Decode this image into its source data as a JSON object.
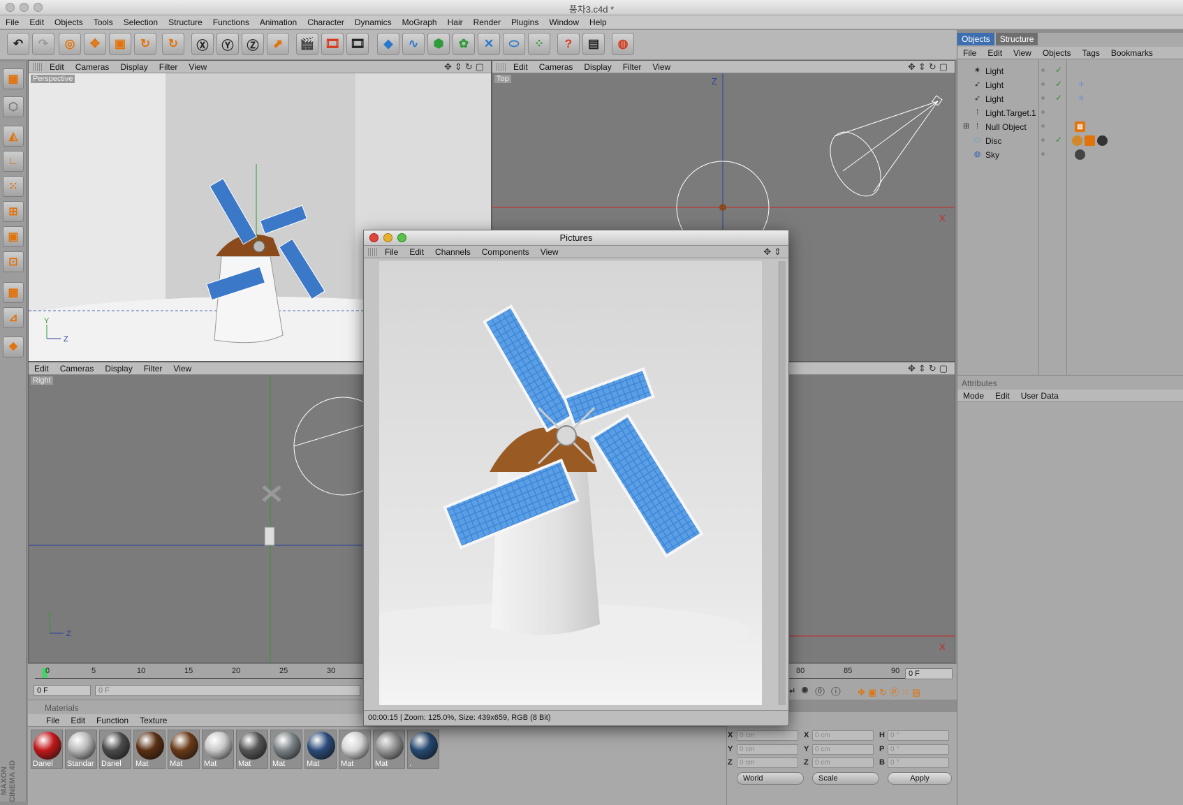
{
  "window": {
    "title": "풍차3.c4d *"
  },
  "menubar": [
    "File",
    "Edit",
    "Objects",
    "Tools",
    "Selection",
    "Structure",
    "Functions",
    "Animation",
    "Character",
    "Dynamics",
    "MoGraph",
    "Hair",
    "Render",
    "Plugins",
    "Window",
    "Help"
  ],
  "viewports": {
    "perspective": {
      "label": "Perspective",
      "menu": [
        "Edit",
        "Cameras",
        "Display",
        "Filter",
        "View"
      ],
      "axis_y": "Y",
      "axis_z": "Z"
    },
    "top": {
      "label": "Top",
      "menu": [
        "Edit",
        "Cameras",
        "Display",
        "Filter",
        "View"
      ],
      "axis_z": "Z",
      "axis_x": "X"
    },
    "right": {
      "label": "Right",
      "menu": [
        "Edit",
        "Cameras",
        "Display",
        "Filter",
        "View"
      ],
      "axis_y": "Y",
      "axis_z": "Z"
    },
    "front": {
      "axis_x": "X"
    }
  },
  "object_manager": {
    "tabs": [
      "Objects",
      "Structure"
    ],
    "menu": [
      "File",
      "Edit",
      "View",
      "Objects",
      "Tags",
      "Bookmarks"
    ],
    "items": [
      {
        "name": "Light",
        "icon": "light-icon"
      },
      {
        "name": "Light",
        "icon": "spot-light-icon"
      },
      {
        "name": "Light",
        "icon": "spot-light-icon"
      },
      {
        "name": "Light.Target.1",
        "icon": "target-icon"
      },
      {
        "name": "Null Object",
        "icon": "null-icon"
      },
      {
        "name": "Disc",
        "icon": "disc-icon"
      },
      {
        "name": "Sky",
        "icon": "sky-icon"
      }
    ]
  },
  "attributes": {
    "title": "Attributes",
    "menu": [
      "Mode",
      "Edit",
      "User Data"
    ]
  },
  "timeline": {
    "ticks": [
      "0",
      "5",
      "10",
      "15",
      "20",
      "25",
      "30",
      "80",
      "85",
      "90"
    ],
    "current_frame": "0 F",
    "end_field": "0 F",
    "start_field": "0 F"
  },
  "materials": {
    "title": "Materials",
    "menu": [
      "File",
      "Edit",
      "Function",
      "Texture"
    ],
    "items": [
      {
        "name": "Danel",
        "color": "#c0181a"
      },
      {
        "name": "Standar",
        "color": "#b9b9b9"
      },
      {
        "name": "Danel",
        "color": "#4a4a4a"
      },
      {
        "name": "Mat",
        "color": "#5a2f12"
      },
      {
        "name": "Mat",
        "color": "#6a3a18"
      },
      {
        "name": "Mat",
        "color": "#c8c8c8"
      },
      {
        "name": "Mat",
        "color": "#555555"
      },
      {
        "name": "Mat",
        "color": "#7a8286"
      },
      {
        "name": "Mat",
        "color": "#2a4c7a"
      },
      {
        "name": "Mat",
        "color": "#d6d6d6"
      },
      {
        "name": "Mat",
        "color": "#9a9a9a"
      },
      {
        "name": ".",
        "color": "#264a74"
      }
    ]
  },
  "coordinates": {
    "rows": [
      {
        "pos_label": "X",
        "pos_value": "0 cm",
        "size_label": "X",
        "size_value": "0 cm",
        "rot_label": "H",
        "rot_value": "0 °"
      },
      {
        "pos_label": "Y",
        "pos_value": "0 cm",
        "size_label": "Y",
        "size_value": "0 cm",
        "rot_label": "P",
        "rot_value": "0 °"
      },
      {
        "pos_label": "Z",
        "pos_value": "0 cm",
        "size_label": "Z",
        "size_value": "0 cm",
        "rot_label": "B",
        "rot_value": "0 °"
      }
    ],
    "mode_select": "World",
    "scale_select": "Scale",
    "apply_label": "Apply"
  },
  "pictures": {
    "title": "Pictures",
    "menu": [
      "File",
      "Edit",
      "Channels",
      "Components",
      "View"
    ],
    "status": "00:00:15 | Zoom: 125.0%, Size: 439x659, RGB (8 Bit)"
  },
  "branding": "MAXON CINEMA 4D",
  "colors": {
    "accent_orange": "#e2720a",
    "panel_blue": "#4d8fd8",
    "x_axis": "#c62828",
    "y_axis": "#2e9b2e",
    "z_axis": "#2a3fa0",
    "selection_tab": "#3d6fb0"
  }
}
